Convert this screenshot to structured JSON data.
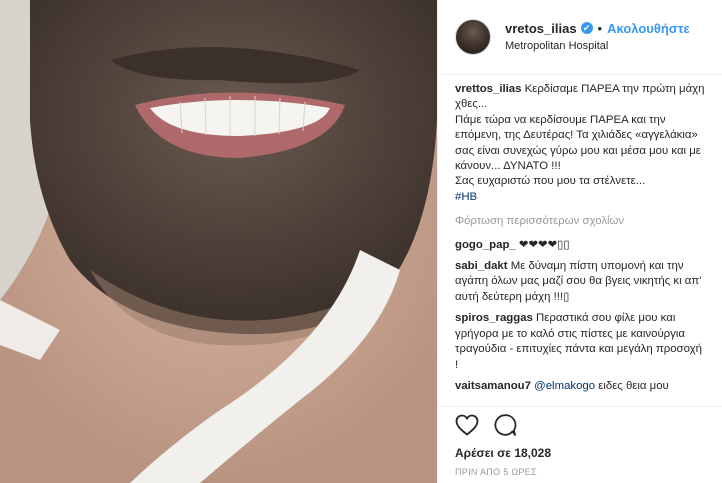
{
  "post": {
    "username": "vretos_ilias",
    "verified_badge": "✔",
    "separator": "•",
    "follow_label": "Ακολουθήστε",
    "location": "Metropolitan Hospital",
    "photo_icon": "bearded-smile-photo"
  },
  "caption": {
    "user": "vrettos_ilias",
    "text": " Κερδίσαμε ΠΑΡΕΑ την πρώτη μάχη χθες...\nΠάμε τώρα να κερδίσουμε ΠΑΡΕΑ και την επόμενη, της Δευτέρας! Τα χιλιάδες «αγγελάκια» σας είναι συνεχώς γύρω μου και μέσα μου και με κάνουν... ΔΥΝΑΤΟ !!!\nΣας ευχαριστώ που μου τα στέλνετε...\n",
    "hashtag": "#HB"
  },
  "load_more": "Φόρτωση περισσότερων σχολίων",
  "comments": [
    {
      "user": "gogo_pap_",
      "text": " ❤❤❤❤▯▯"
    },
    {
      "user": "sabi_dakt",
      "text": " Με δύναμη πίστη υπομονή και την αγάπη όλων μας μαζί σου θα βγεις νικητής κι απ' αυτή δεύτερη μάχη !!!▯"
    },
    {
      "user": "spiros_raggas",
      "text": " Περαστικά σου φίλε μου και γρήγορα με το καλό στις πίστες με καινούργια τραγούδια - επιτυχίες πάντα και μεγάλη προσοχή !"
    },
    {
      "user": "vaitsamanou7",
      "mention": " @elmakogo",
      "text": " ειδες θεια μου"
    }
  ],
  "actions": {
    "like_icon": "heart-outline-icon",
    "comment_icon": "comment-bubble-icon",
    "likes_text": "Αρέσει σε 18,028",
    "timestamp": "ΠΡΙΝ ΑΠΟ 5 ΩΡΕΣ"
  }
}
